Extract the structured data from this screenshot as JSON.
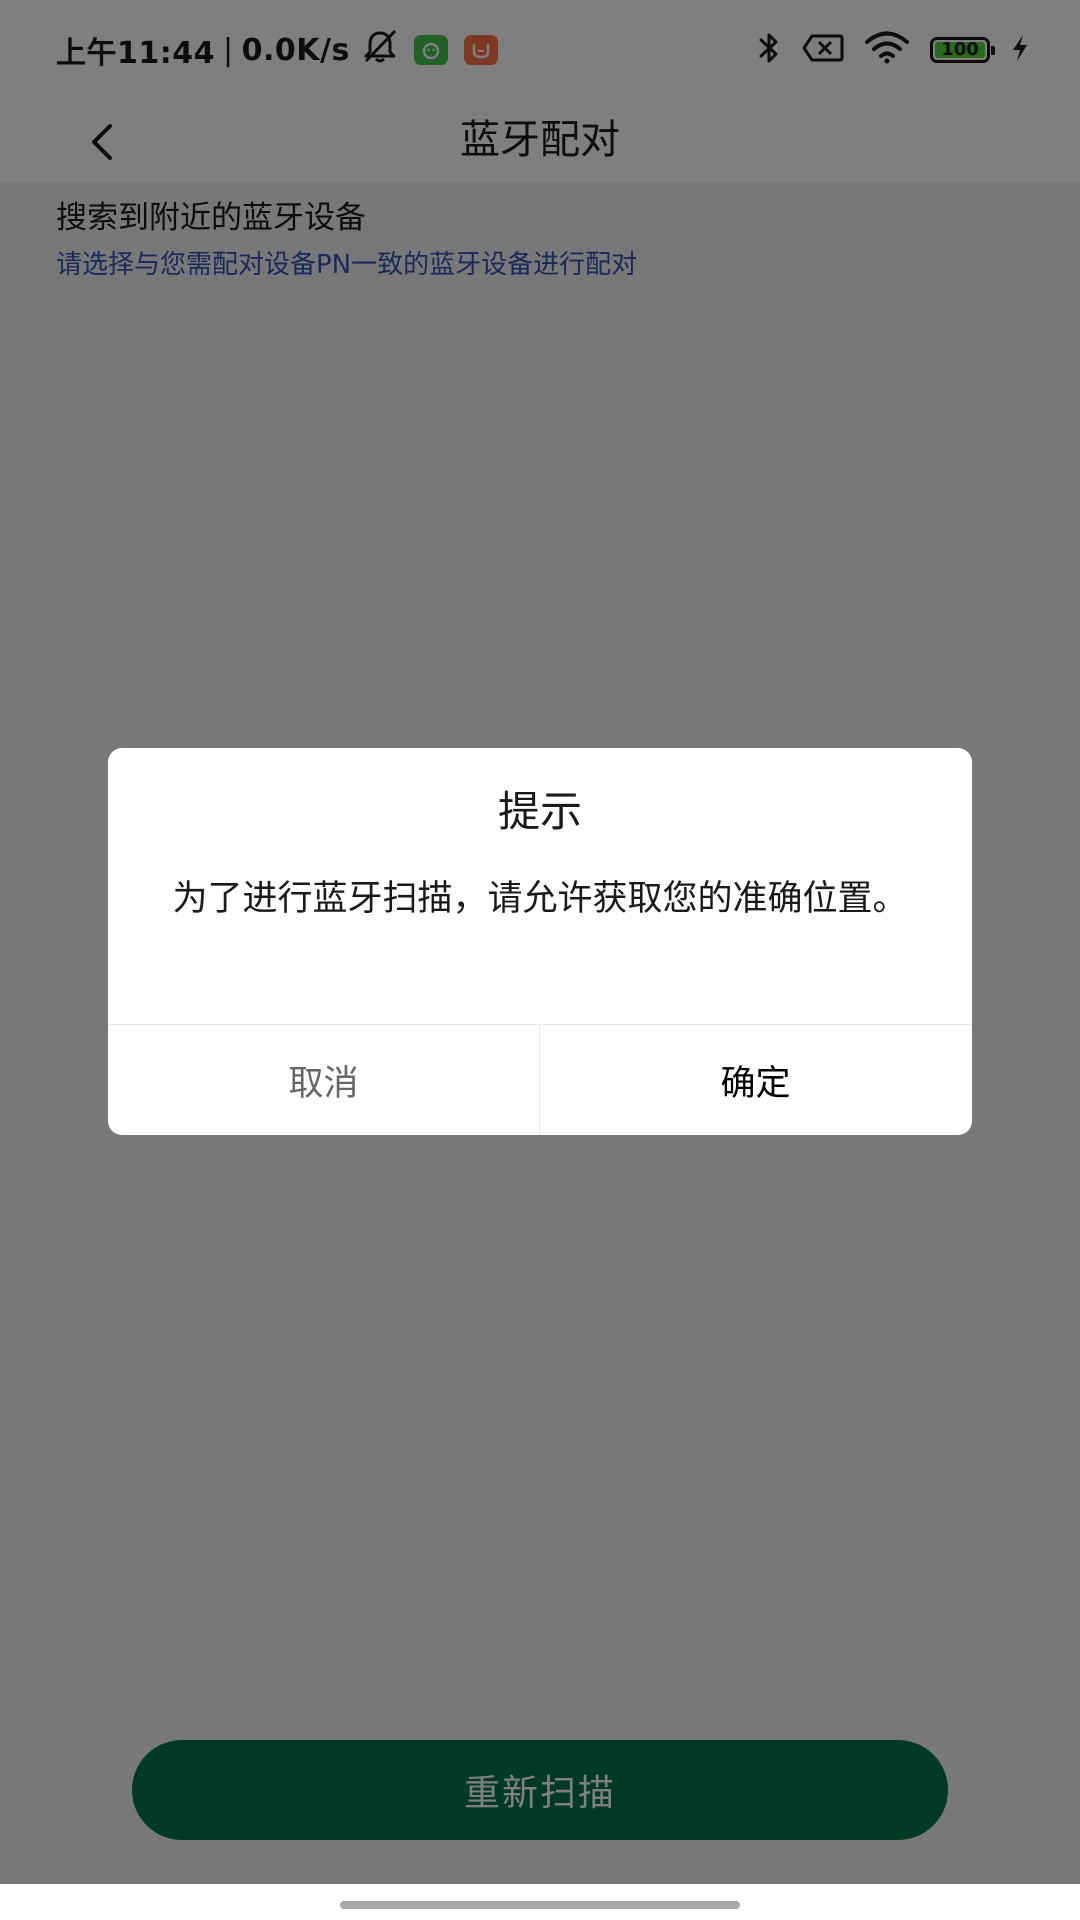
{
  "status_bar": {
    "time": "上午11:44",
    "separator": "|",
    "network_speed": "0.0K/s",
    "battery_level": "100",
    "battery_percent": 100,
    "icons": [
      "mute-bell-icon",
      "green-app-badge-icon",
      "orange-app-badge-icon",
      "bluetooth-icon",
      "sim-no-signal-icon",
      "wifi-icon",
      "battery-icon",
      "charging-bolt-icon"
    ]
  },
  "header": {
    "title": "蓝牙配对",
    "back_icon": "chevron-left-icon"
  },
  "content": {
    "section_title": "搜索到附近的蓝牙设备",
    "section_hint": "请选择与您需配对设备PN一致的蓝牙设备进行配对",
    "rescan_button_label": "重新扫描"
  },
  "dialog": {
    "title": "提示",
    "message": "为了进行蓝牙扫描，请允许获取您的准确位置。",
    "cancel_label": "取消",
    "confirm_label": "确定"
  },
  "colors": {
    "primary_green": "#00754a",
    "hint_blue": "#2f55b5",
    "app_badge_green": "#45c04a",
    "app_badge_orange": "#ff7043",
    "battery_green": "#56d33a",
    "overlay": "rgba(0,0,0,0.5)"
  }
}
